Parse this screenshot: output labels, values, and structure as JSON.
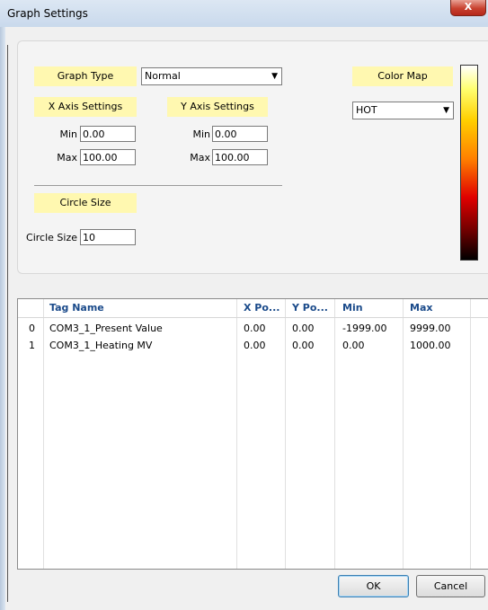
{
  "window": {
    "title": "Graph Settings",
    "close_glyph": "X"
  },
  "graph": {
    "type_label": "Graph Type",
    "type_value": "Normal",
    "color_map_label": "Color Map",
    "color_map_value": "HOT"
  },
  "x_axis": {
    "label": "X Axis Settings",
    "min_label": "Min",
    "min_value": "0.00",
    "max_label": "Max",
    "max_value": "100.00"
  },
  "y_axis": {
    "label": "Y Axis Settings",
    "min_label": "Min",
    "min_value": "0.00",
    "max_label": "Max",
    "max_value": "100.00"
  },
  "circle": {
    "header": "Circle Size",
    "label": "Circle Size",
    "value": "10"
  },
  "table": {
    "columns": [
      "Tag Name",
      "X Po...",
      "Y Po...",
      "Min",
      "Max"
    ],
    "rows": [
      {
        "index": "0",
        "tag": "COM3_1_Present Value",
        "x": "0.00",
        "y": "0.00",
        "min": "-1999.00",
        "max": "9999.00"
      },
      {
        "index": "1",
        "tag": "COM3_1_Heating MV",
        "x": "0.00",
        "y": "0.00",
        "min": "0.00",
        "max": "1000.00"
      }
    ]
  },
  "buttons": {
    "ok": "OK",
    "cancel": "Cancel"
  }
}
